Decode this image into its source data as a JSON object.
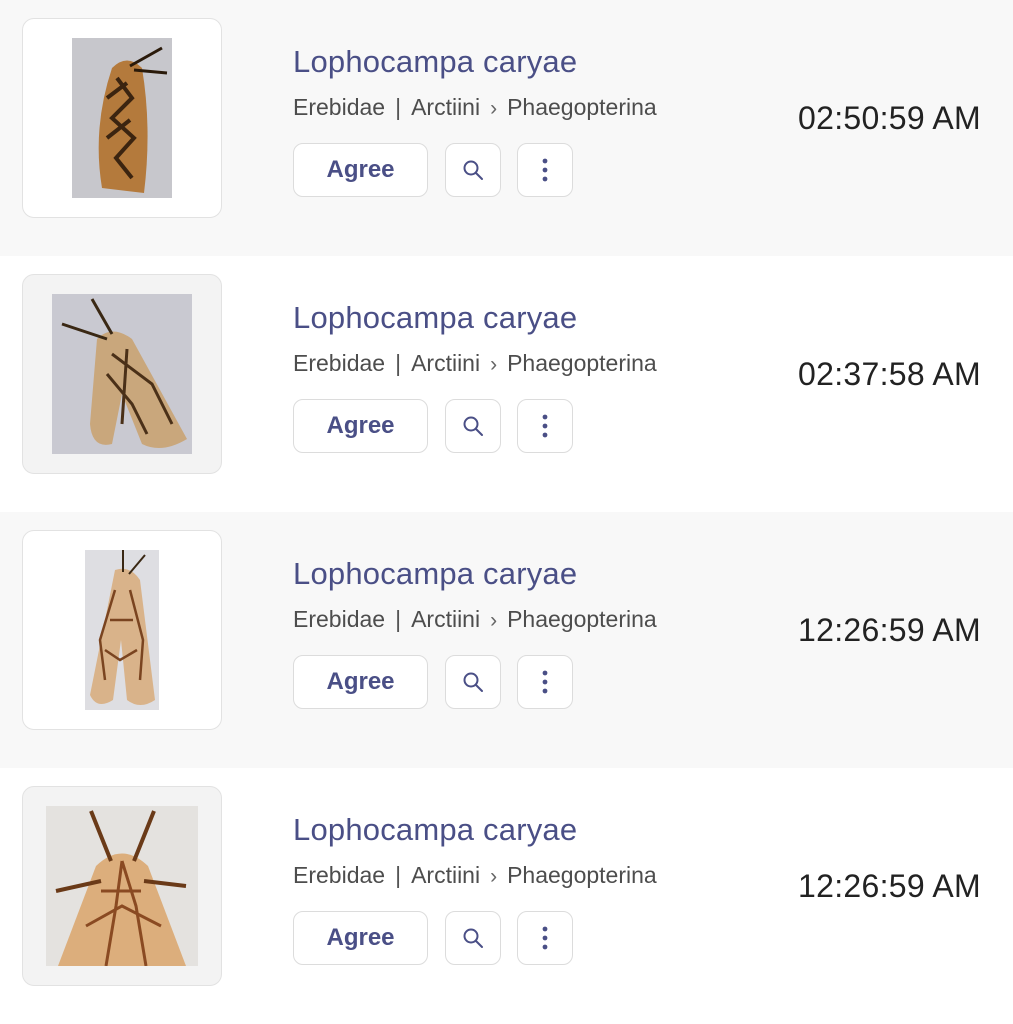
{
  "rows": [
    {
      "name": "Lophocampa caryae",
      "family": "Erebidae",
      "tribe": "Arctiini",
      "subtribe": "Phaegopterina",
      "agree_label": "Agree",
      "time": "02:50:59 AM",
      "thumb_icon": "moth-photo-icon",
      "bg_color": "#c7c7cc",
      "moth_color": "#b47a3c",
      "vein_color": "#3b2410"
    },
    {
      "name": "Lophocampa caryae",
      "family": "Erebidae",
      "tribe": "Arctiini",
      "subtribe": "Phaegopterina",
      "agree_label": "Agree",
      "time": "02:37:58 AM",
      "thumb_icon": "moth-photo-icon",
      "bg_color": "#c9c9d1",
      "moth_color": "#c9a77c",
      "vein_color": "#4a3018"
    },
    {
      "name": "Lophocampa caryae",
      "family": "Erebidae",
      "tribe": "Arctiini",
      "subtribe": "Phaegopterina",
      "agree_label": "Agree",
      "time": "12:26:59 AM",
      "thumb_icon": "moth-photo-icon",
      "bg_color": "#dedee2",
      "moth_color": "#d9b38a",
      "vein_color": "#7a4420"
    },
    {
      "name": "Lophocampa caryae",
      "family": "Erebidae",
      "tribe": "Arctiini",
      "subtribe": "Phaegopterina",
      "agree_label": "Agree",
      "time": "12:26:59 AM",
      "thumb_icon": "moth-photo-icon",
      "bg_color": "#e4e2df",
      "moth_color": "#dcae7c",
      "vein_color": "#8a4a22"
    }
  ]
}
